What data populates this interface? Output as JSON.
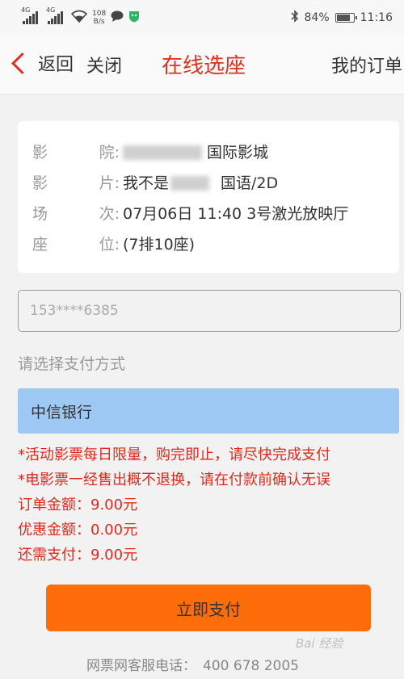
{
  "statusbar": {
    "network1": "4G",
    "network2": "4G",
    "speed_value": "108",
    "speed_unit": "B/s",
    "battery": "84%",
    "battery_level": 0.84,
    "time": "11:16"
  },
  "navbar": {
    "back_label": "返回",
    "close_label": "关闭",
    "title": "在线选座",
    "orders_label": "我的订单"
  },
  "info": {
    "cinema_label": [
      "影",
      "院:"
    ],
    "cinema_value": "国际影城",
    "film_label": [
      "影",
      "片:"
    ],
    "film_value_prefix": "我不是",
    "film_value_suffix": "国语/2D",
    "session_label": [
      "场",
      "次:"
    ],
    "session_value": "07月06日 11:40 3号激光放映厅",
    "seat_label": [
      "座",
      "位:"
    ],
    "seat_value": "(7排10座)"
  },
  "phone": {
    "value": "153****6385"
  },
  "payment": {
    "label": "请选择支付方式",
    "selected_bank": "中信银行"
  },
  "notes": [
    "*活动影票每日限量，购完即止，请尽快完成支付",
    "*电影票一经售出概不退换，请在付款前确认无误"
  ],
  "amounts": [
    "订单金额：9.00元",
    "优惠金额：0.00元",
    "还需支付：9.00元"
  ],
  "pay_button": "立即支付",
  "service": {
    "label": "网票网客服电话：",
    "number": "400 678 2005"
  },
  "watermark": "Bai 经验",
  "colors": {
    "accent": "#e0301e",
    "pay_button": "#ff6c0a",
    "bank_highlight": "#9ec9f5"
  }
}
